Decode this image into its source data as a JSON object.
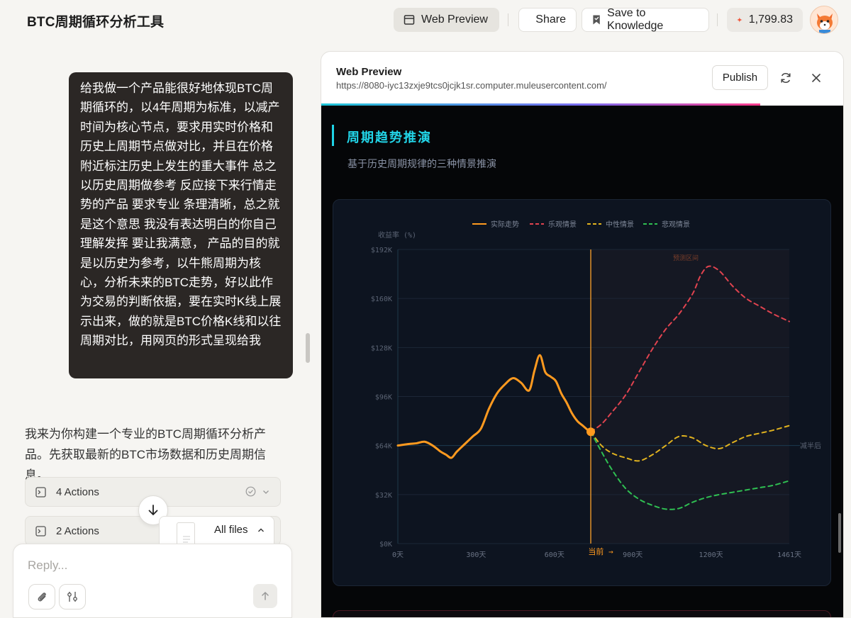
{
  "app": {
    "title": "BTC周期循环分析工具"
  },
  "toolbar": {
    "web_preview": "Web Preview",
    "share": "Share",
    "save_to_knowledge": "Save to Knowledge",
    "credits": "1,799.83"
  },
  "chat": {
    "user_message": "给我做一个产品能很好地体现BTC周期循环的，以4年周期为标准，以减产时间为核心节点，要求用实时价格和历史上周期节点做对比，并且在价格附近标注历史上发生的重大事件 总之以历史周期做参考 反应接下来行情走势的产品 要求专业 条理清晰，总之就是这个意思 我没有表达明白的你自己理解发挥 要让我满意， 产品的目的就是以历史为参考，以牛熊周期为核心，分析未来的BTC走势，好以此作为交易的判断依据，要在实时K线上展示出来，做的就是BTC价格K线和以往周期对比，用网页的形式呈现给我",
    "assistant_message": "我来为你构建一个专业的BTC周期循环分析产品。先获取最新的BTC市场数据和历史周期信息。",
    "actions": [
      {
        "label": "4 Actions"
      },
      {
        "label": "2 Actions"
      }
    ],
    "files_label": "All files",
    "reply_placeholder": "Reply..."
  },
  "preview": {
    "title": "Web Preview",
    "url": "https://8080-iyc13zxje9tcs0jcjk1sr.computer.muleusercontent.com/",
    "publish": "Publish",
    "section_title": "周期趋势推演",
    "section_subtitle": "基于历史周期规律的三种情景推演"
  },
  "chart_data": {
    "type": "line",
    "ylabel": "收益率 (%)",
    "ylim": [
      0,
      192000
    ],
    "y_ticks": [
      "$0K",
      "$32K",
      "$64K",
      "$96K",
      "$128K",
      "$160K",
      "$192K"
    ],
    "xlim": [
      0,
      1461
    ],
    "x_ticks": [
      "0天",
      "300天",
      "600天",
      "900天",
      "1200天",
      "1461天"
    ],
    "legend_position": "top",
    "current_label": "当前 →",
    "current_day": 720,
    "forecast_label": "预测区间",
    "halving_label": "减半后",
    "colors": {
      "actual": "#ff9a1f",
      "bull": "#e0434f",
      "neutral": "#e0b21f",
      "bear": "#2fbf52"
    },
    "series": [
      {
        "name": "实际走势",
        "x": [
          0,
          40,
          70,
          100,
          130,
          160,
          180,
          200,
          220,
          250,
          280,
          310,
          340,
          370,
          400,
          430,
          460,
          490,
          510,
          530,
          550,
          570,
          590,
          610,
          630,
          650,
          670,
          690,
          710,
          720
        ],
        "y": [
          64000,
          65000,
          65500,
          66500,
          64000,
          60000,
          58000,
          56000,
          60000,
          65000,
          70000,
          75000,
          88000,
          98000,
          104000,
          108000,
          105000,
          100000,
          113000,
          123000,
          112000,
          109000,
          106000,
          98000,
          92000,
          85000,
          80000,
          77000,
          74000,
          73000
        ]
      },
      {
        "name": "乐观情景",
        "x": [
          720,
          760,
          800,
          850,
          900,
          950,
          1000,
          1050,
          1100,
          1130,
          1160,
          1200,
          1250,
          1300,
          1350,
          1400,
          1461
        ],
        "y": [
          73000,
          78000,
          86000,
          97000,
          112000,
          127000,
          140000,
          150000,
          163000,
          175000,
          181000,
          178000,
          168000,
          160000,
          155000,
          150000,
          145000
        ]
      },
      {
        "name": "中性情景",
        "x": [
          720,
          760,
          800,
          850,
          900,
          950,
          1000,
          1050,
          1100,
          1150,
          1200,
          1250,
          1300,
          1350,
          1400,
          1461
        ],
        "y": [
          73000,
          64000,
          59000,
          56000,
          54000,
          58000,
          64000,
          70000,
          69000,
          64000,
          62000,
          66000,
          70000,
          72000,
          74000,
          77000
        ]
      },
      {
        "name": "悲观情景",
        "x": [
          720,
          760,
          800,
          850,
          900,
          950,
          1000,
          1050,
          1100,
          1150,
          1200,
          1250,
          1300,
          1350,
          1400,
          1461
        ],
        "y": [
          73000,
          60000,
          48000,
          36000,
          29000,
          25000,
          22500,
          23000,
          27000,
          30000,
          32000,
          33500,
          35000,
          36500,
          38000,
          41000
        ]
      }
    ]
  }
}
